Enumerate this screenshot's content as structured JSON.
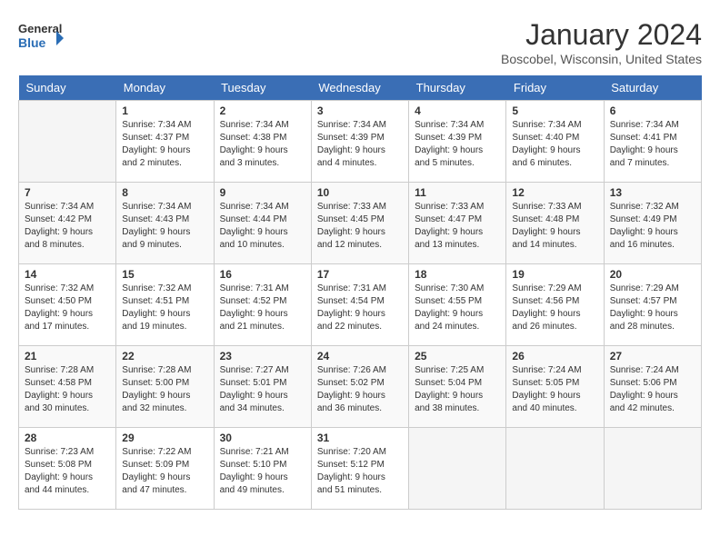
{
  "header": {
    "logo_general": "General",
    "logo_blue": "Blue",
    "month_title": "January 2024",
    "location": "Boscobel, Wisconsin, United States"
  },
  "days_of_week": [
    "Sunday",
    "Monday",
    "Tuesday",
    "Wednesday",
    "Thursday",
    "Friday",
    "Saturday"
  ],
  "weeks": [
    [
      {
        "num": "",
        "info": ""
      },
      {
        "num": "1",
        "info": "Sunrise: 7:34 AM\nSunset: 4:37 PM\nDaylight: 9 hours\nand 2 minutes."
      },
      {
        "num": "2",
        "info": "Sunrise: 7:34 AM\nSunset: 4:38 PM\nDaylight: 9 hours\nand 3 minutes."
      },
      {
        "num": "3",
        "info": "Sunrise: 7:34 AM\nSunset: 4:39 PM\nDaylight: 9 hours\nand 4 minutes."
      },
      {
        "num": "4",
        "info": "Sunrise: 7:34 AM\nSunset: 4:39 PM\nDaylight: 9 hours\nand 5 minutes."
      },
      {
        "num": "5",
        "info": "Sunrise: 7:34 AM\nSunset: 4:40 PM\nDaylight: 9 hours\nand 6 minutes."
      },
      {
        "num": "6",
        "info": "Sunrise: 7:34 AM\nSunset: 4:41 PM\nDaylight: 9 hours\nand 7 minutes."
      }
    ],
    [
      {
        "num": "7",
        "info": "Sunrise: 7:34 AM\nSunset: 4:42 PM\nDaylight: 9 hours\nand 8 minutes."
      },
      {
        "num": "8",
        "info": "Sunrise: 7:34 AM\nSunset: 4:43 PM\nDaylight: 9 hours\nand 9 minutes."
      },
      {
        "num": "9",
        "info": "Sunrise: 7:34 AM\nSunset: 4:44 PM\nDaylight: 9 hours\nand 10 minutes."
      },
      {
        "num": "10",
        "info": "Sunrise: 7:33 AM\nSunset: 4:45 PM\nDaylight: 9 hours\nand 12 minutes."
      },
      {
        "num": "11",
        "info": "Sunrise: 7:33 AM\nSunset: 4:47 PM\nDaylight: 9 hours\nand 13 minutes."
      },
      {
        "num": "12",
        "info": "Sunrise: 7:33 AM\nSunset: 4:48 PM\nDaylight: 9 hours\nand 14 minutes."
      },
      {
        "num": "13",
        "info": "Sunrise: 7:32 AM\nSunset: 4:49 PM\nDaylight: 9 hours\nand 16 minutes."
      }
    ],
    [
      {
        "num": "14",
        "info": "Sunrise: 7:32 AM\nSunset: 4:50 PM\nDaylight: 9 hours\nand 17 minutes."
      },
      {
        "num": "15",
        "info": "Sunrise: 7:32 AM\nSunset: 4:51 PM\nDaylight: 9 hours\nand 19 minutes."
      },
      {
        "num": "16",
        "info": "Sunrise: 7:31 AM\nSunset: 4:52 PM\nDaylight: 9 hours\nand 21 minutes."
      },
      {
        "num": "17",
        "info": "Sunrise: 7:31 AM\nSunset: 4:54 PM\nDaylight: 9 hours\nand 22 minutes."
      },
      {
        "num": "18",
        "info": "Sunrise: 7:30 AM\nSunset: 4:55 PM\nDaylight: 9 hours\nand 24 minutes."
      },
      {
        "num": "19",
        "info": "Sunrise: 7:29 AM\nSunset: 4:56 PM\nDaylight: 9 hours\nand 26 minutes."
      },
      {
        "num": "20",
        "info": "Sunrise: 7:29 AM\nSunset: 4:57 PM\nDaylight: 9 hours\nand 28 minutes."
      }
    ],
    [
      {
        "num": "21",
        "info": "Sunrise: 7:28 AM\nSunset: 4:58 PM\nDaylight: 9 hours\nand 30 minutes."
      },
      {
        "num": "22",
        "info": "Sunrise: 7:28 AM\nSunset: 5:00 PM\nDaylight: 9 hours\nand 32 minutes."
      },
      {
        "num": "23",
        "info": "Sunrise: 7:27 AM\nSunset: 5:01 PM\nDaylight: 9 hours\nand 34 minutes."
      },
      {
        "num": "24",
        "info": "Sunrise: 7:26 AM\nSunset: 5:02 PM\nDaylight: 9 hours\nand 36 minutes."
      },
      {
        "num": "25",
        "info": "Sunrise: 7:25 AM\nSunset: 5:04 PM\nDaylight: 9 hours\nand 38 minutes."
      },
      {
        "num": "26",
        "info": "Sunrise: 7:24 AM\nSunset: 5:05 PM\nDaylight: 9 hours\nand 40 minutes."
      },
      {
        "num": "27",
        "info": "Sunrise: 7:24 AM\nSunset: 5:06 PM\nDaylight: 9 hours\nand 42 minutes."
      }
    ],
    [
      {
        "num": "28",
        "info": "Sunrise: 7:23 AM\nSunset: 5:08 PM\nDaylight: 9 hours\nand 44 minutes."
      },
      {
        "num": "29",
        "info": "Sunrise: 7:22 AM\nSunset: 5:09 PM\nDaylight: 9 hours\nand 47 minutes."
      },
      {
        "num": "30",
        "info": "Sunrise: 7:21 AM\nSunset: 5:10 PM\nDaylight: 9 hours\nand 49 minutes."
      },
      {
        "num": "31",
        "info": "Sunrise: 7:20 AM\nSunset: 5:12 PM\nDaylight: 9 hours\nand 51 minutes."
      },
      {
        "num": "",
        "info": ""
      },
      {
        "num": "",
        "info": ""
      },
      {
        "num": "",
        "info": ""
      }
    ]
  ]
}
